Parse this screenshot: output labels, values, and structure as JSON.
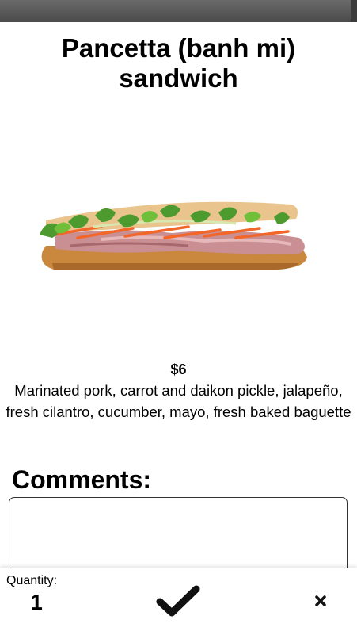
{
  "item": {
    "title": "Pancetta (banh mi) sandwich",
    "image_alt": "Pancetta banh mi sandwich",
    "price": "$6",
    "description": "Marinated pork, carrot and daikon pickle, jalapeño, fresh cilantro, cucumber, mayo, fresh baked baguette"
  },
  "comments": {
    "label": "Comments:",
    "value": "",
    "placeholder": ""
  },
  "footer": {
    "quantity_label": "Quantity:",
    "quantity_value": "1",
    "confirm_icon": "checkmark-icon",
    "cancel_icon": "close-icon"
  },
  "colors": {
    "status_bar": "#4a4a4a",
    "text": "#000000",
    "background": "#ffffff"
  }
}
